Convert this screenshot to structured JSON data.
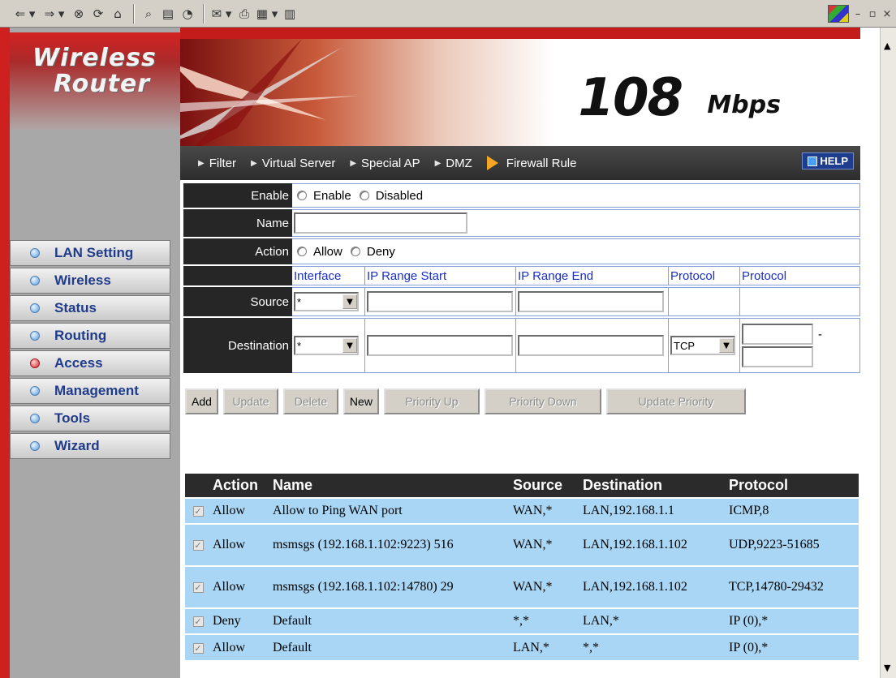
{
  "toolbar": {
    "icons": [
      "back-icon",
      "forward-icon",
      "stop-icon",
      "refresh-icon",
      "home-icon",
      "search-icon",
      "favorites-icon",
      "history-icon",
      "mail-icon",
      "print-icon",
      "edit-icon",
      "discuss-icon"
    ],
    "glyphs": {
      "back": "⇐ ▾",
      "forward": "⇒ ▾",
      "stop": "⊗",
      "refresh": "⟳",
      "home": "⌂",
      "search": "⌕",
      "favorites": "▤",
      "history": "◔",
      "mail": "✉ ▾",
      "print": "⎙",
      "edit": "▦ ▾",
      "discuss": "▥",
      "minimize": "–",
      "restore": "▫",
      "close": "×"
    }
  },
  "sidebar": {
    "brand_line1": "Wireless",
    "brand_line2": "Router",
    "items": [
      {
        "label": "LAN Setting",
        "active": false
      },
      {
        "label": "Wireless",
        "active": false
      },
      {
        "label": "Status",
        "active": false
      },
      {
        "label": "Routing",
        "active": false
      },
      {
        "label": "Access",
        "active": true
      },
      {
        "label": "Management",
        "active": false
      },
      {
        "label": "Tools",
        "active": false
      },
      {
        "label": "Wizard",
        "active": false
      }
    ]
  },
  "banner": {
    "speed": "108",
    "unit": "Mbps"
  },
  "tabs": {
    "filter": "Filter",
    "virtual_server": "Virtual Server",
    "special_ap": "Special AP",
    "dmz": "DMZ",
    "firewall_rule": "Firewall Rule",
    "help": "HELP"
  },
  "form": {
    "enable_label": "Enable",
    "enable_opt": "Enable",
    "disabled_opt": "Disabled",
    "name_label": "Name",
    "name_value": "",
    "action_label": "Action",
    "allow_opt": "Allow",
    "deny_opt": "Deny",
    "hdr_interface": "Interface",
    "hdr_ip_start": "IP Range Start",
    "hdr_ip_end": "IP Range End",
    "hdr_protocol": "Protocol",
    "hdr_protocol2": "Protocol",
    "source_label": "Source",
    "source_iface": "*",
    "dest_label": "Destination",
    "dest_iface": "*",
    "dest_protocol": "TCP",
    "port_sep": "-"
  },
  "buttons": {
    "add": "Add",
    "update": "Update",
    "delete": "Delete",
    "new": "New",
    "priority_up": "Priority Up",
    "priority_down": "Priority Down",
    "update_priority": "Update Priority"
  },
  "rules": {
    "headers": {
      "action": "Action",
      "name": "Name",
      "source": "Source",
      "destination": "Destination",
      "protocol": "Protocol"
    },
    "rows": [
      {
        "checked": true,
        "action": "Allow",
        "name": "Allow to Ping WAN port",
        "source": "WAN,*",
        "destination": "LAN,192.168.1.1",
        "protocol": "ICMP,8"
      },
      {
        "checked": true,
        "action": "Allow",
        "name": "msmsgs (192.168.1.102:9223) 516",
        "source": "WAN,*",
        "destination": "LAN,192.168.1.102",
        "protocol": "UDP,9223-51685"
      },
      {
        "checked": true,
        "action": "Allow",
        "name": "msmsgs (192.168.1.102:14780) 29",
        "source": "WAN,*",
        "destination": "LAN,192.168.1.102",
        "protocol": "TCP,14780-29432"
      },
      {
        "checked": true,
        "action": "Deny",
        "name": "Default",
        "source": "*,*",
        "destination": "LAN,*",
        "protocol": "IP (0),*"
      },
      {
        "checked": true,
        "action": "Allow",
        "name": "Default",
        "source": "LAN,*",
        "destination": "*,*",
        "protocol": "IP (0),*"
      }
    ]
  },
  "colors": {
    "accent_red": "#c41b1b",
    "nav_text": "#1f3b8a",
    "row_bg": "#a9d6f5"
  }
}
